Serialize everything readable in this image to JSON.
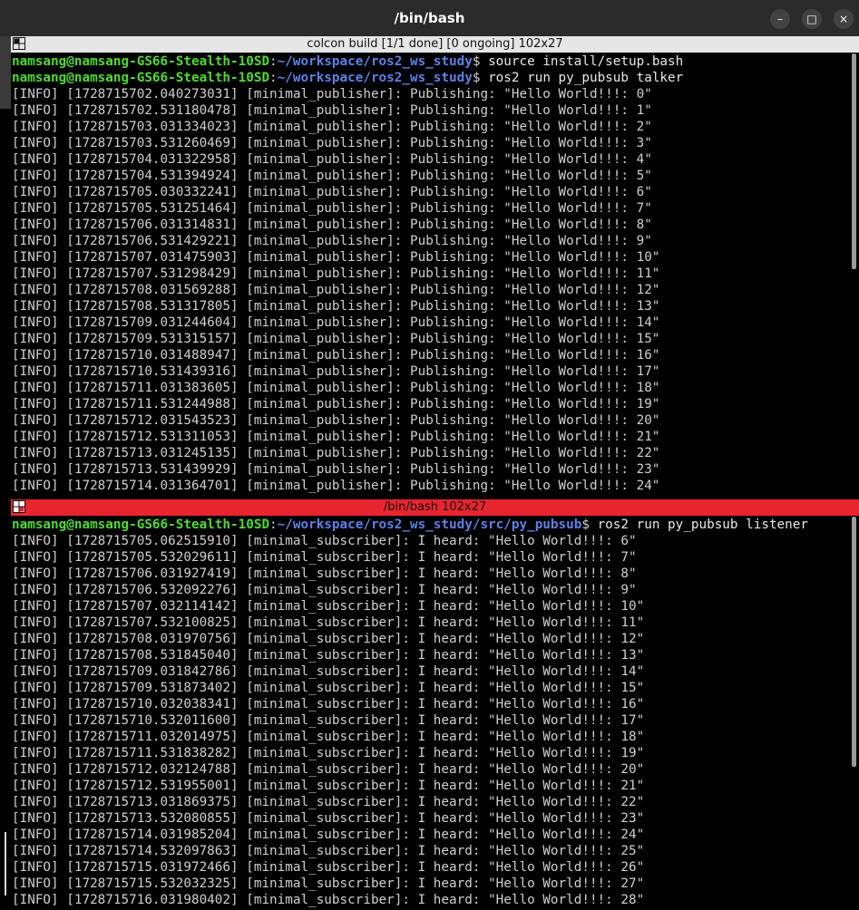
{
  "window": {
    "title": "/bin/bash",
    "minimize_label": "–",
    "maximize_label": "□",
    "close_label": "×"
  },
  "top_pane": {
    "title": "colcon build [1/1 done] [0 ongoing] 102x27",
    "commands": [
      {
        "user": "namsang@namsang-GS66-Stealth-10SD",
        "path": "~/workspace/ros2_ws_study",
        "cmd": "source install/setup.bash"
      },
      {
        "user": "namsang@namsang-GS66-Stealth-10SD",
        "path": "~/workspace/ros2_ws_study",
        "cmd": "ros2 run py_pubsub talker"
      }
    ],
    "lines": [
      "[INFO] [1728715702.040273031] [minimal_publisher]: Publishing: \"Hello World!!!: 0\"",
      "[INFO] [1728715702.531180478] [minimal_publisher]: Publishing: \"Hello World!!!: 1\"",
      "[INFO] [1728715703.031334023] [minimal_publisher]: Publishing: \"Hello World!!!: 2\"",
      "[INFO] [1728715703.531260469] [minimal_publisher]: Publishing: \"Hello World!!!: 3\"",
      "[INFO] [1728715704.031322958] [minimal_publisher]: Publishing: \"Hello World!!!: 4\"",
      "[INFO] [1728715704.531394924] [minimal_publisher]: Publishing: \"Hello World!!!: 5\"",
      "[INFO] [1728715705.030332241] [minimal_publisher]: Publishing: \"Hello World!!!: 6\"",
      "[INFO] [1728715705.531251464] [minimal_publisher]: Publishing: \"Hello World!!!: 7\"",
      "[INFO] [1728715706.031314831] [minimal_publisher]: Publishing: \"Hello World!!!: 8\"",
      "[INFO] [1728715706.531429221] [minimal_publisher]: Publishing: \"Hello World!!!: 9\"",
      "[INFO] [1728715707.031475903] [minimal_publisher]: Publishing: \"Hello World!!!: 10\"",
      "[INFO] [1728715707.531298429] [minimal_publisher]: Publishing: \"Hello World!!!: 11\"",
      "[INFO] [1728715708.031569288] [minimal_publisher]: Publishing: \"Hello World!!!: 12\"",
      "[INFO] [1728715708.531317805] [minimal_publisher]: Publishing: \"Hello World!!!: 13\"",
      "[INFO] [1728715709.031244604] [minimal_publisher]: Publishing: \"Hello World!!!: 14\"",
      "[INFO] [1728715709.531315157] [minimal_publisher]: Publishing: \"Hello World!!!: 15\"",
      "[INFO] [1728715710.031488947] [minimal_publisher]: Publishing: \"Hello World!!!: 16\"",
      "[INFO] [1728715710.531439316] [minimal_publisher]: Publishing: \"Hello World!!!: 17\"",
      "[INFO] [1728715711.031383605] [minimal_publisher]: Publishing: \"Hello World!!!: 18\"",
      "[INFO] [1728715711.531244988] [minimal_publisher]: Publishing: \"Hello World!!!: 19\"",
      "[INFO] [1728715712.031543523] [minimal_publisher]: Publishing: \"Hello World!!!: 20\"",
      "[INFO] [1728715712.531311053] [minimal_publisher]: Publishing: \"Hello World!!!: 21\"",
      "[INFO] [1728715713.031245135] [minimal_publisher]: Publishing: \"Hello World!!!: 22\"",
      "[INFO] [1728715713.531439929] [minimal_publisher]: Publishing: \"Hello World!!!: 23\"",
      "[INFO] [1728715714.031364701] [minimal_publisher]: Publishing: \"Hello World!!!: 24\""
    ]
  },
  "bottom_pane": {
    "title": "/bin/bash 102x27",
    "commands": [
      {
        "user": "namsang@namsang-GS66-Stealth-10SD",
        "path": "~/workspace/ros2_ws_study/src/py_pubsub",
        "cmd": "ros2 run py_pubsub listener"
      }
    ],
    "lines": [
      "[INFO] [1728715705.062515910] [minimal_subscriber]: I heard: \"Hello World!!!: 6\"",
      "[INFO] [1728715705.532029611] [minimal_subscriber]: I heard: \"Hello World!!!: 7\"",
      "[INFO] [1728715706.031927419] [minimal_subscriber]: I heard: \"Hello World!!!: 8\"",
      "[INFO] [1728715706.532092276] [minimal_subscriber]: I heard: \"Hello World!!!: 9\"",
      "[INFO] [1728715707.032114142] [minimal_subscriber]: I heard: \"Hello World!!!: 10\"",
      "[INFO] [1728715707.532100825] [minimal_subscriber]: I heard: \"Hello World!!!: 11\"",
      "[INFO] [1728715708.031970756] [minimal_subscriber]: I heard: \"Hello World!!!: 12\"",
      "[INFO] [1728715708.531845040] [minimal_subscriber]: I heard: \"Hello World!!!: 13\"",
      "[INFO] [1728715709.031842786] [minimal_subscriber]: I heard: \"Hello World!!!: 14\"",
      "[INFO] [1728715709.531873402] [minimal_subscriber]: I heard: \"Hello World!!!: 15\"",
      "[INFO] [1728715710.032038341] [minimal_subscriber]: I heard: \"Hello World!!!: 16\"",
      "[INFO] [1728715710.532011600] [minimal_subscriber]: I heard: \"Hello World!!!: 17\"",
      "[INFO] [1728715711.032014975] [minimal_subscriber]: I heard: \"Hello World!!!: 18\"",
      "[INFO] [1728715711.531838282] [minimal_subscriber]: I heard: \"Hello World!!!: 19\"",
      "[INFO] [1728715712.032124788] [minimal_subscriber]: I heard: \"Hello World!!!: 20\"",
      "[INFO] [1728715712.531955001] [minimal_subscriber]: I heard: \"Hello World!!!: 21\"",
      "[INFO] [1728715713.031869375] [minimal_subscriber]: I heard: \"Hello World!!!: 22\"",
      "[INFO] [1728715713.532080855] [minimal_subscriber]: I heard: \"Hello World!!!: 23\"",
      "[INFO] [1728715714.031985204] [minimal_subscriber]: I heard: \"Hello World!!!: 24\"",
      "[INFO] [1728715714.532097863] [minimal_subscriber]: I heard: \"Hello World!!!: 25\"",
      "[INFO] [1728715715.031972466] [minimal_subscriber]: I heard: \"Hello World!!!: 26\"",
      "[INFO] [1728715715.532032325] [minimal_subscriber]: I heard: \"Hello World!!!: 27\"",
      "[INFO] [1728715716.031980402] [minimal_subscriber]: I heard: \"Hello World!!!: 28\""
    ]
  },
  "colors": {
    "user": "#4edc2e",
    "path": "#5b82ea",
    "output": "#cfcfcf",
    "active_pane_header": "#e8252f",
    "inactive_pane_header": "#e6e6e6",
    "titlebar": "#2b2b2b"
  }
}
